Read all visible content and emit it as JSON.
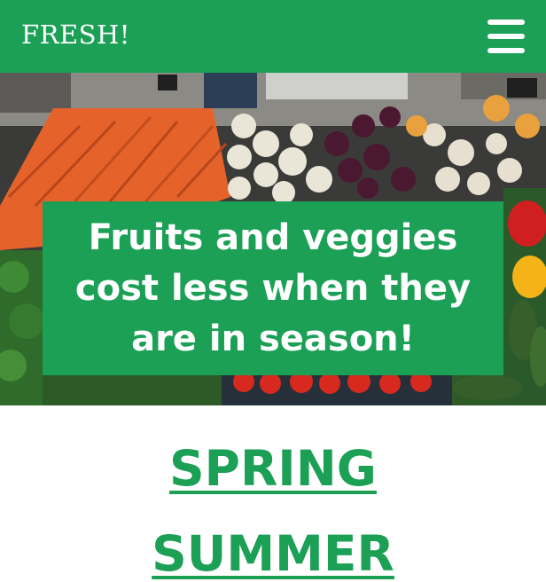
{
  "header": {
    "brand": "FRESH!",
    "menu_icon": "hamburger-menu-icon"
  },
  "hero": {
    "image_label": "Fruits and vegetables at a market stall",
    "headline": "Fruits and veggies\ncost less when they\nare in season!"
  },
  "seasons": [
    {
      "label": "SPRING"
    },
    {
      "label": "SUMMER"
    }
  ],
  "colors": {
    "brand_green": "#1ba055",
    "text_on_green": "#ffffff"
  }
}
